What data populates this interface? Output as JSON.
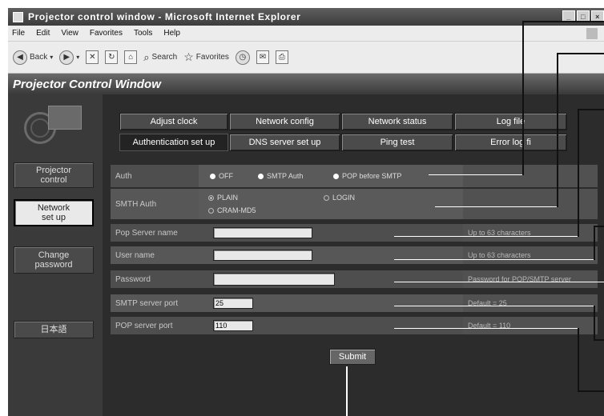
{
  "window": {
    "title": "Projector control window - Microsoft Internet Explorer",
    "controls": [
      "_",
      "□",
      "×"
    ]
  },
  "menu": [
    "File",
    "Edit",
    "View",
    "Favorites",
    "Tools",
    "Help"
  ],
  "toolbar": {
    "back": "Back",
    "search": "Search",
    "favorites": "Favorites"
  },
  "header": {
    "title": "Projector Control Window"
  },
  "sidebar": {
    "items": [
      {
        "label": "Projector\ncontrol"
      },
      {
        "label": "Network\nset up"
      },
      {
        "label": "Change\npassword"
      },
      {
        "label": "日本語"
      }
    ]
  },
  "tabs": {
    "row1": [
      "Adjust clock",
      "Network config",
      "Network status",
      "Log file"
    ],
    "row2": [
      "Authentication set up",
      "DNS server set up",
      "Ping test",
      "Error log fi"
    ]
  },
  "form": {
    "auth": {
      "label": "Auth",
      "options": [
        "OFF",
        "SMTP Auth",
        "POP before SMTP"
      ]
    },
    "smtp_auth": {
      "label": "SMTH Auth",
      "options": [
        "PLAIN",
        "LOGIN",
        "CRAM-MD5"
      ]
    },
    "pop_server": {
      "label": "Pop Server name",
      "value": "",
      "help": "Up to 63 characters"
    },
    "user_name": {
      "label": "User name",
      "value": "",
      "help": "Up to 63 characters"
    },
    "password": {
      "label": "Password",
      "value": "",
      "help": "Password for POP/SMTP server"
    },
    "smtp_port": {
      "label": "SMTP server port",
      "value": "25",
      "help": "Default = 25"
    },
    "pop_port": {
      "label": "POP server port",
      "value": "110",
      "help": "Default = 110"
    },
    "submit": "Submit"
  }
}
